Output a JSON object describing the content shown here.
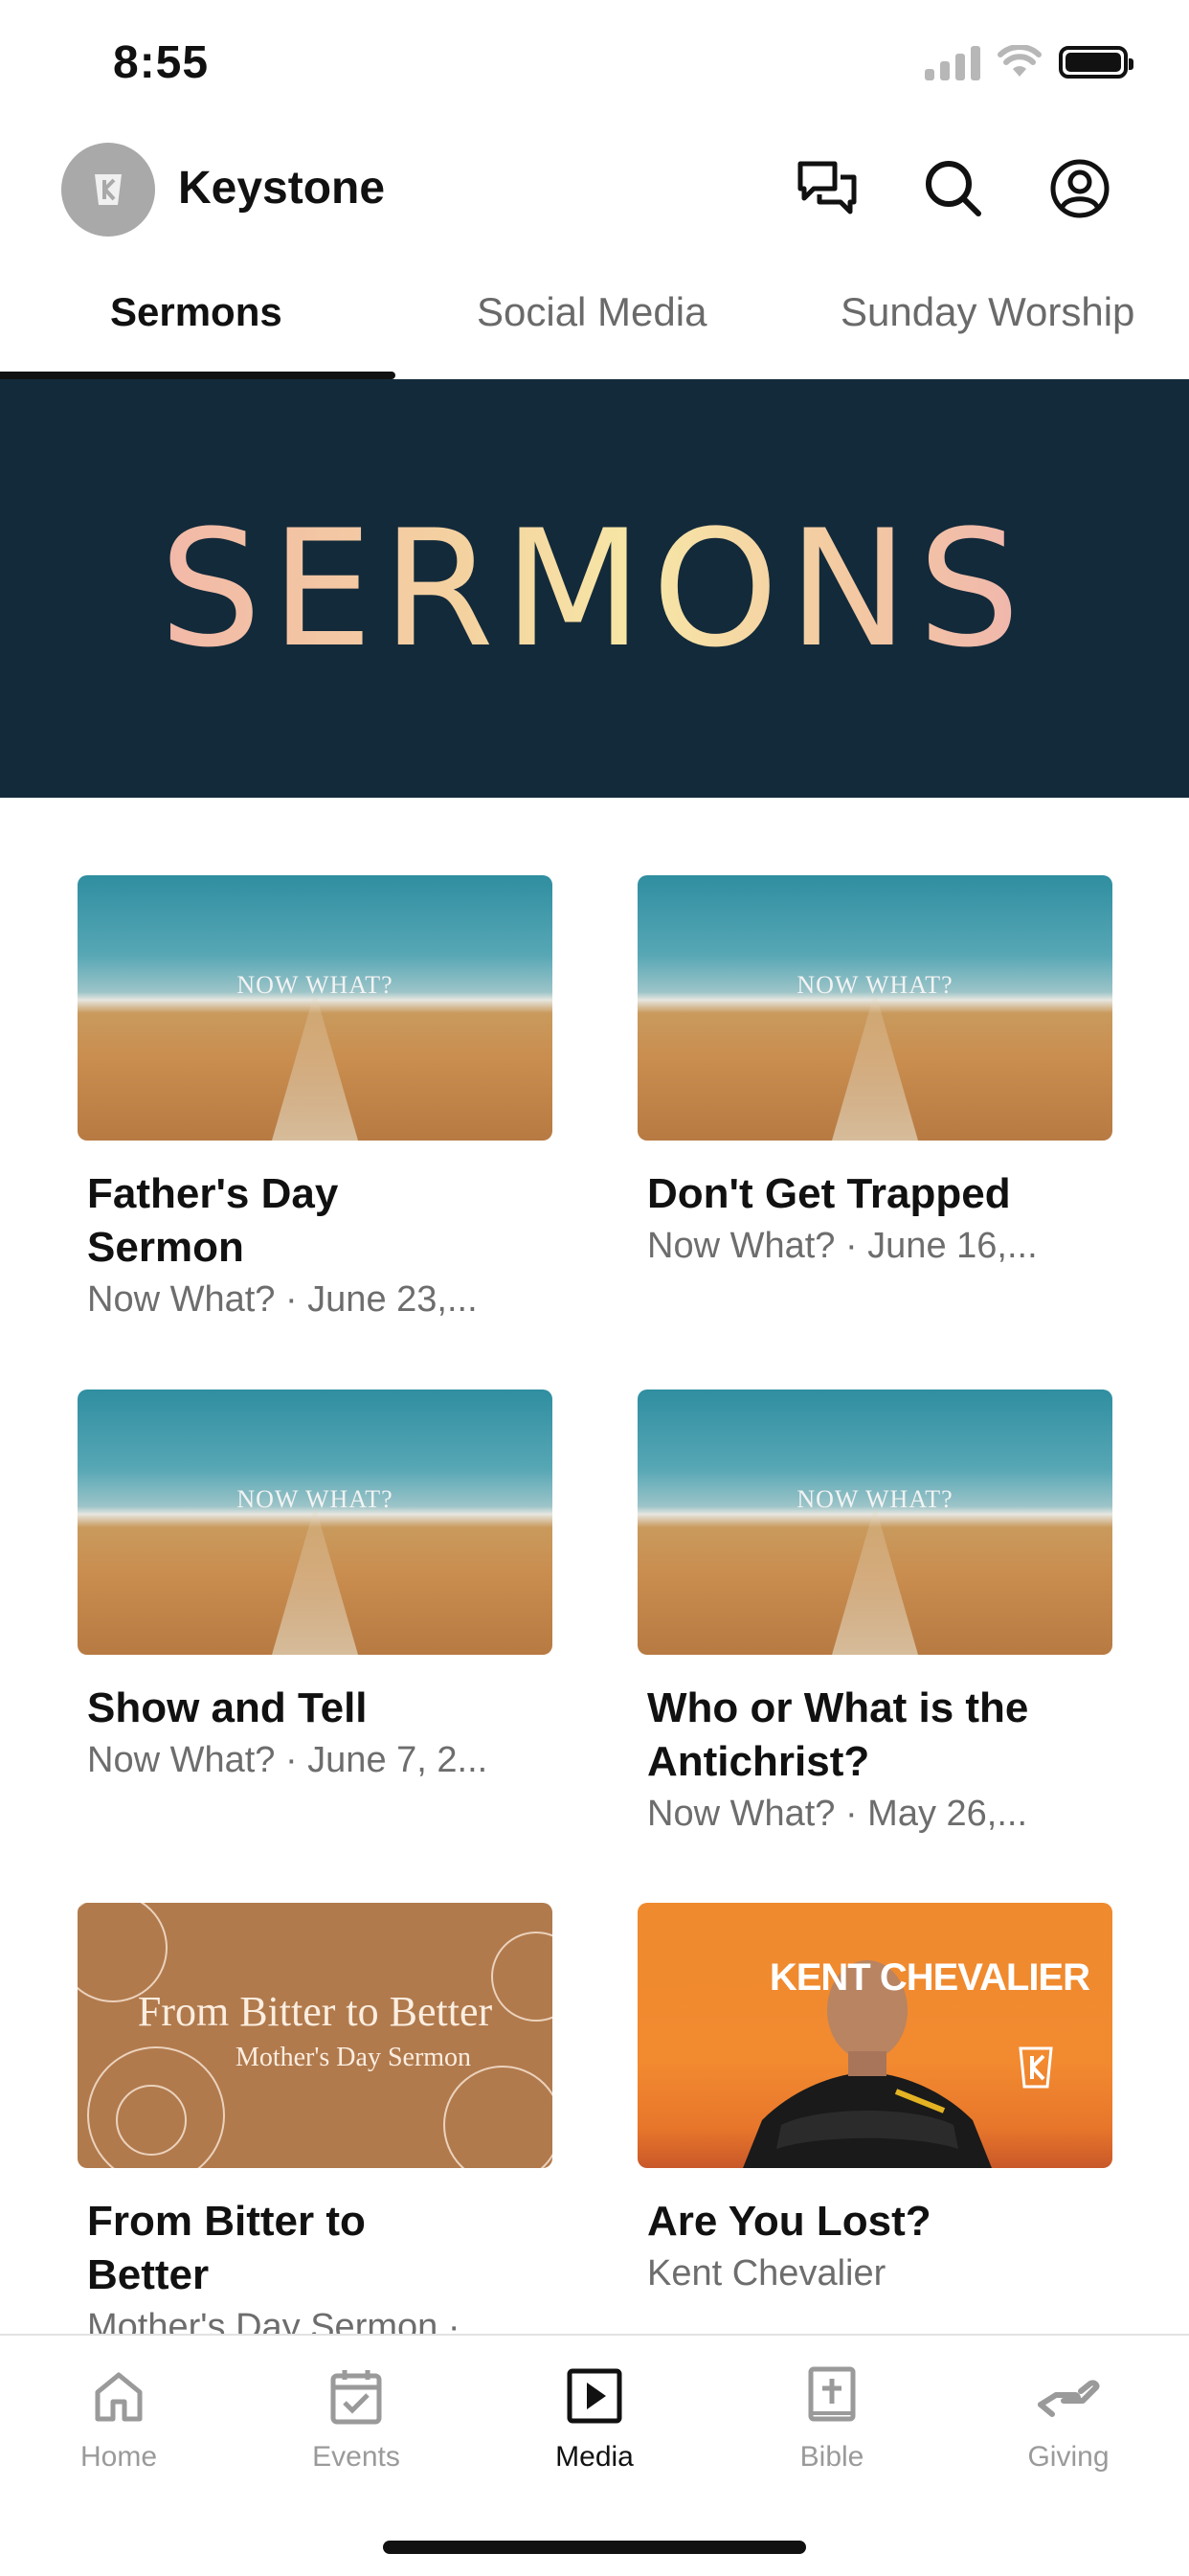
{
  "status_bar": {
    "time": "8:55"
  },
  "header": {
    "app_name": "Keystone"
  },
  "tabs": [
    {
      "label": "Sermons",
      "active": true
    },
    {
      "label": "Social Media",
      "active": false
    },
    {
      "label": "Sunday Worship",
      "active": false
    }
  ],
  "banner": {
    "text": "SERMONS"
  },
  "sermons": [
    {
      "title": "Father's Day Sermon",
      "subtitle": "Now What? · June 23,...",
      "thumb_caption": "NOW WHAT?"
    },
    {
      "title": "Don't Get Trapped",
      "subtitle": "Now What? · June 16,...",
      "thumb_caption": "NOW WHAT?"
    },
    {
      "title": "Show and Tell",
      "subtitle": "Now What? · June 7, 2...",
      "thumb_caption": "NOW WHAT?"
    },
    {
      "title": "Who or What is the Antichrist?",
      "subtitle": "Now What? · May 26,...",
      "thumb_caption": "NOW WHAT?"
    },
    {
      "title": "From Bitter to Better",
      "subtitle": "Mother's Day Sermon ·",
      "thumb_title": "From Bitter to Better",
      "thumb_subtitle": "Mother's Day Sermon"
    },
    {
      "title": "Are You Lost?",
      "subtitle": "Kent Chevalier",
      "thumb_name": "KENT CHEVALIER"
    }
  ],
  "bottom_nav": [
    {
      "label": "Home",
      "icon": "home-icon",
      "active": false
    },
    {
      "label": "Events",
      "icon": "calendar-icon",
      "active": false
    },
    {
      "label": "Media",
      "icon": "play-icon",
      "active": true
    },
    {
      "label": "Bible",
      "icon": "bible-icon",
      "active": false
    },
    {
      "label": "Giving",
      "icon": "giving-hand-icon",
      "active": false
    }
  ],
  "colors": {
    "banner_bg": "#132a3a",
    "accent": "#111111",
    "inactive": "#9a9a9a"
  }
}
